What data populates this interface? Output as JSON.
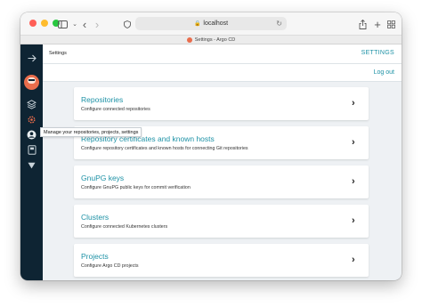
{
  "browser": {
    "url": "localhost",
    "tab_title": "Settings - Argo CD"
  },
  "tooltip": "Manage your repositories, projects, settings",
  "header": {
    "breadcrumb": "Settings",
    "title": "SETTINGS",
    "logout": "Log out"
  },
  "cards": [
    {
      "title": "Repositories",
      "description": "Configure connected repositories"
    },
    {
      "title": "Repository certificates and known hosts",
      "description": "Configure repository certificates and known hosts for connecting Git repositories"
    },
    {
      "title": "GnuPG keys",
      "description": "Configure GnuPG public keys for commit verification"
    },
    {
      "title": "Clusters",
      "description": "Configure connected Kubernetes clusters"
    },
    {
      "title": "Projects",
      "description": "Configure Argo CD projects"
    }
  ],
  "colors": {
    "accent": "#1e92a6",
    "sidebar": "#0e2433",
    "brand": "#e96d4c"
  }
}
